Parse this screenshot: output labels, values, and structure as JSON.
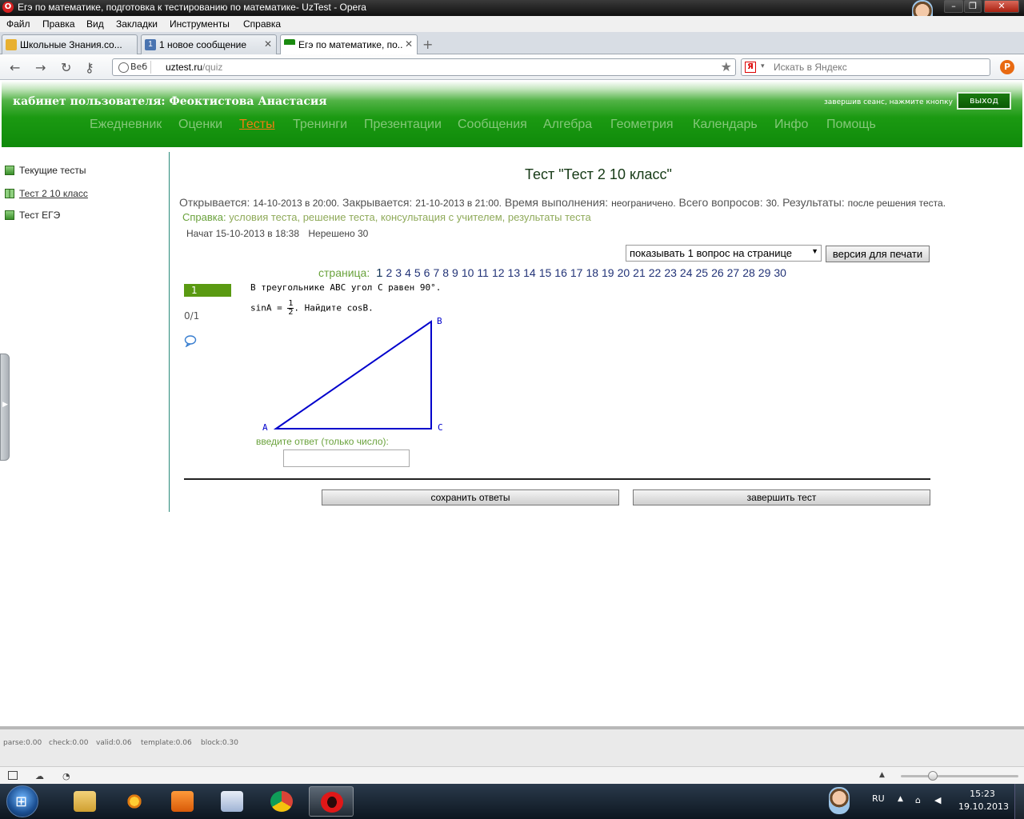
{
  "window": {
    "title": "Егэ по математике, подготовка к тестированию по математике- UzTest - Opera"
  },
  "menu": {
    "items": [
      "Файл",
      "Правка",
      "Вид",
      "Закладки",
      "Инструменты",
      "Справка"
    ]
  },
  "tabs": [
    {
      "label": "Школьные Знания.co...",
      "active": false
    },
    {
      "label": "1 новое сообщение",
      "active": false
    },
    {
      "label": "Егэ по математике, по...",
      "active": true
    }
  ],
  "address": {
    "web_chip": "Веб",
    "host": "uztest.ru",
    "path": "/quiz",
    "search_placeholder": "Искать в Яндекс"
  },
  "site": {
    "cabinet": "кабинет пользователя: Феоктистова Анастасия",
    "logout_hint": "завершив сеанс, нажмите кнопку",
    "logout_label": "выход",
    "nav": [
      "Ежедневник",
      "Оценки",
      "Тесты",
      "Тренинги",
      "Презентации",
      "Сообщения",
      "Алгебра",
      "Геометрия",
      "Календарь",
      "Инфо",
      "Помощь"
    ],
    "nav_active": "Тесты"
  },
  "sidebar": {
    "items": [
      {
        "label": "Текущие тесты",
        "link": false
      },
      {
        "label": "Тест 2 10 класс",
        "link": true
      },
      {
        "label": "Тест ЕГЭ",
        "link": false
      }
    ]
  },
  "test": {
    "title": "Тест \"Тест 2 10 класс\"",
    "opens_label": "Открывается:",
    "opens_value": "14-10-2013 в 20:00.",
    "closes_label": "Закрывается:",
    "closes_value": "21-10-2013 в 21:00.",
    "duration_label": "Время выполнения:",
    "duration_value": "неограничено.",
    "total_label": "Всего вопросов:",
    "total_value": "30.",
    "results_label": "Результаты:",
    "results_value": "после решения теста.",
    "help_label": "Справка:",
    "help_links": [
      "условия теста",
      "решение теста",
      "консультация с учителем",
      "результаты теста"
    ],
    "started": "Начат 15-10-2013 в 18:38",
    "unsolved": "Нерешено 30",
    "per_page_option": "показывать 1 вопрос на странице",
    "print_label": "версия для печати",
    "pager_label": "страница:",
    "pages": [
      "1",
      "2",
      "3",
      "4",
      "5",
      "6",
      "7",
      "8",
      "9",
      "10",
      "11",
      "12",
      "13",
      "14",
      "15",
      "16",
      "17",
      "18",
      "19",
      "20",
      "21",
      "22",
      "23",
      "24",
      "25",
      "26",
      "27",
      "28",
      "29",
      "30"
    ],
    "current_page": "1"
  },
  "question": {
    "number": "1",
    "score": "0/1",
    "line1": "В треугольнике ABC угол C равен 90°.",
    "line2_prefix": "sinA = ",
    "frac_num": "1",
    "frac_den": "2",
    "line2_suffix": ". Найдите cosB.",
    "vertex_a": "A",
    "vertex_b": "B",
    "vertex_c": "C",
    "answer_label": "введите ответ (только число):",
    "answer_value": "",
    "save_label": "сохранить ответы",
    "finish_label": "завершить тест",
    "figure_color": "#0000cc"
  },
  "debug": {
    "parse": "parse:0.00",
    "check": "check:0.00",
    "valid": "valid:0.06",
    "template": "template:0.06",
    "block": "block:0.30"
  },
  "taskbar": {
    "lang": "RU",
    "time": "15:23",
    "date": "19.10.2013"
  },
  "colors": {
    "header_green": "#1b9a12",
    "nav_active": "#f07d12",
    "accent_green": "#6aa23c"
  }
}
